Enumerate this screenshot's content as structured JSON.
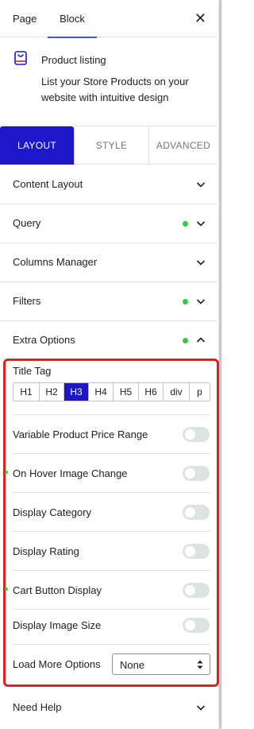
{
  "sidebar_tabs": {
    "page": "Page",
    "block": "Block",
    "close_icon": "close-icon"
  },
  "block_card": {
    "icon": "product-box-icon",
    "name": "Product listing",
    "description": "List your Store Products on your website with intuitive design"
  },
  "settings_tabs": [
    {
      "label": "LAYOUT",
      "active": true
    },
    {
      "label": "STYLE",
      "active": false
    },
    {
      "label": "ADVANCED",
      "active": false
    }
  ],
  "panels": [
    {
      "title": "Content Layout",
      "modified": false,
      "expanded": false
    },
    {
      "title": "Query",
      "modified": true,
      "expanded": false
    },
    {
      "title": "Columns Manager",
      "modified": false,
      "expanded": false
    },
    {
      "title": "Filters",
      "modified": true,
      "expanded": false
    },
    {
      "title": "Extra Options",
      "modified": true,
      "expanded": true
    }
  ],
  "extra_options": {
    "title_tag": {
      "label": "Title Tag",
      "options": [
        "H1",
        "H2",
        "H3",
        "H4",
        "H5",
        "H6",
        "div",
        "p"
      ],
      "selected": "H3"
    },
    "toggles": [
      {
        "label": "Variable Product Price Range",
        "on": false,
        "modified": false
      },
      {
        "label": "On Hover Image Change",
        "on": false,
        "modified": true
      },
      {
        "label": "Display Category",
        "on": false,
        "modified": false
      },
      {
        "label": "Display Rating",
        "on": false,
        "modified": false
      },
      {
        "label": "Cart Button Display",
        "on": false,
        "modified": true
      },
      {
        "label": "Display Image Size",
        "on": false,
        "modified": false
      }
    ],
    "load_more": {
      "label": "Load More Options",
      "value": "None"
    }
  },
  "need_help": {
    "title": "Need Help",
    "expanded": false
  },
  "colors": {
    "accent": "#1c17c9",
    "modified_dot": "#2ecc40",
    "highlight_border": "#e21d24"
  }
}
